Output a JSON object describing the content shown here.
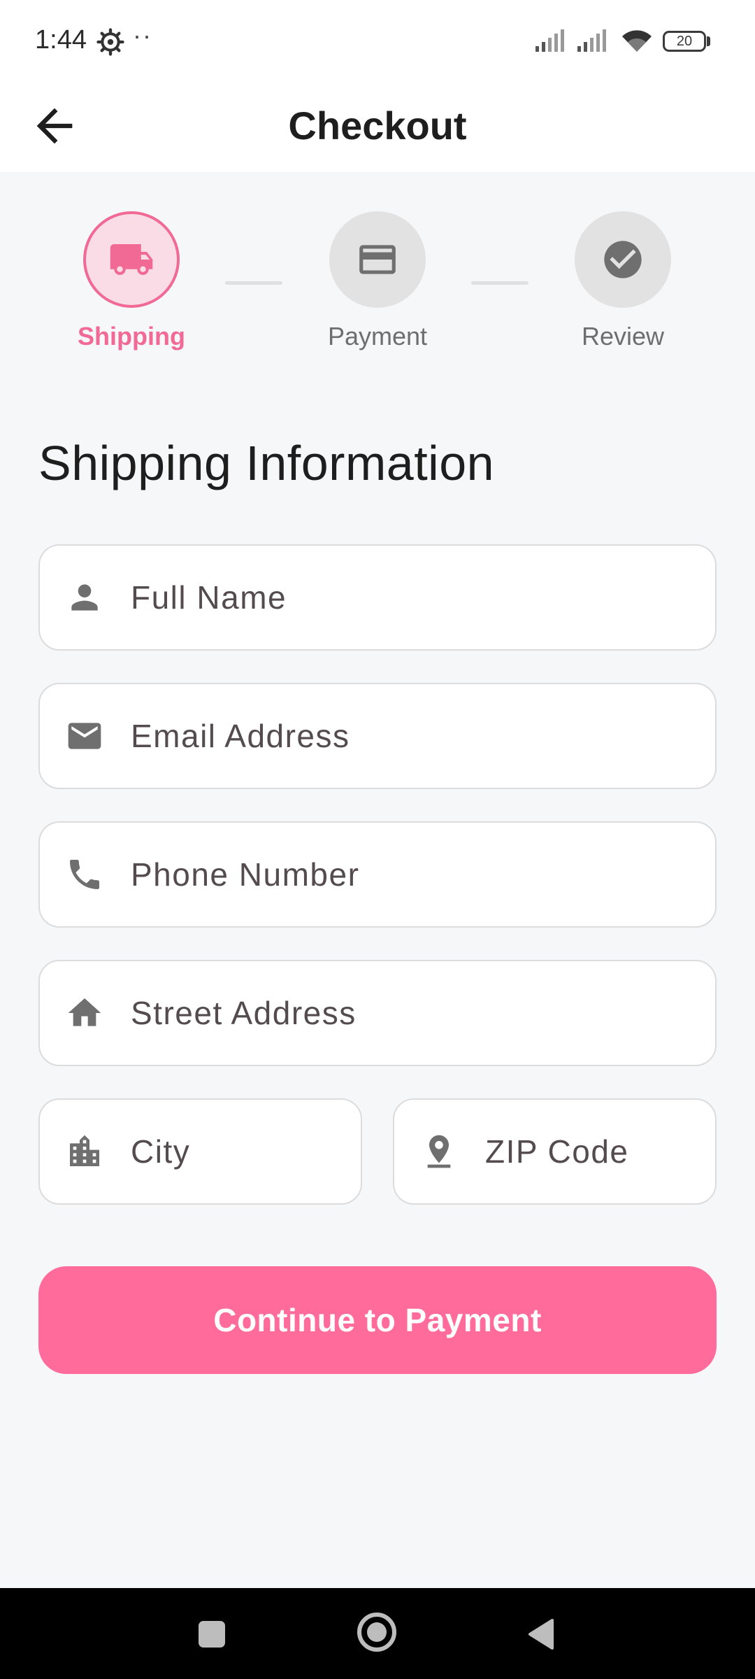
{
  "status_bar": {
    "time": "1:44",
    "dots": "··",
    "battery": "20"
  },
  "app_bar": {
    "title": "Checkout"
  },
  "stepper": {
    "steps": [
      {
        "label": "Shipping",
        "active": true
      },
      {
        "label": "Payment",
        "active": false
      },
      {
        "label": "Review",
        "active": false
      }
    ]
  },
  "form": {
    "heading": "Shipping Information",
    "fields": {
      "full_name": {
        "placeholder": "Full Name",
        "value": "",
        "icon": "person-icon"
      },
      "email": {
        "placeholder": "Email Address",
        "value": "",
        "icon": "mail-icon"
      },
      "phone": {
        "placeholder": "Phone Number",
        "value": "",
        "icon": "phone-icon"
      },
      "street": {
        "placeholder": "Street Address",
        "value": "",
        "icon": "home-icon"
      },
      "city": {
        "placeholder": "City",
        "value": "",
        "icon": "city-icon"
      },
      "zip": {
        "placeholder": "ZIP Code",
        "value": "",
        "icon": "location-pin-icon"
      }
    },
    "submit_label": "Continue to Payment"
  },
  "colors": {
    "accent": "#FF6B9B",
    "accent_dark": "#F06A95",
    "accent_light": "#FADCE6",
    "background": "#F6F7F9",
    "inactive_step": "#E2E2E2",
    "icon_gray": "#6F6F6F"
  }
}
